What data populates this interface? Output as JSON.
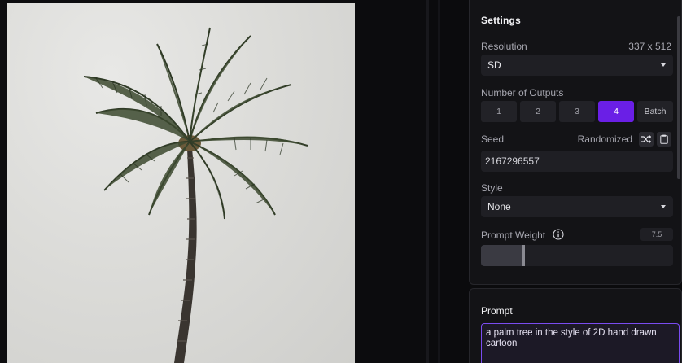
{
  "settings": {
    "title": "Settings",
    "resolution": {
      "label": "Resolution",
      "value": "337 x 512",
      "selected": "SD"
    },
    "outputs": {
      "label": "Number of Outputs",
      "options": [
        "1",
        "2",
        "3",
        "4",
        "Batch"
      ],
      "selected": "4"
    },
    "seed": {
      "label": "Seed",
      "mode": "Randomized",
      "value": "2167296557"
    },
    "style": {
      "label": "Style",
      "selected": "None"
    },
    "prompt_weight": {
      "label": "Prompt Weight",
      "value": "7.5",
      "slider_fraction": 0.22
    }
  },
  "prompt": {
    "title": "Prompt",
    "text": "a palm tree in the style of 2D hand drawn cartoon"
  },
  "icons": [
    "shuffle-icon",
    "clipboard-icon",
    "info-icon",
    "chevron-down-icon"
  ],
  "colors": {
    "accent": "#6a1fe6",
    "prompt_border": "#7a4cf0"
  }
}
